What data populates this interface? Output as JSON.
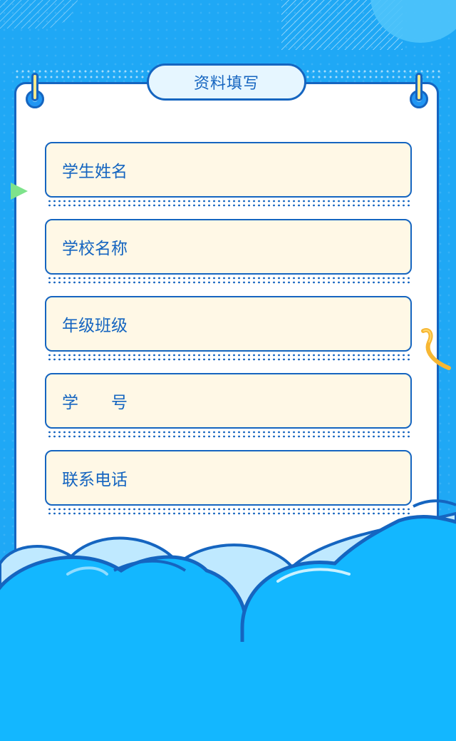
{
  "form": {
    "title": "资料填写",
    "fields": [
      {
        "label": "学生姓名"
      },
      {
        "label": "学校名称"
      },
      {
        "label": "年级班级"
      },
      {
        "label": "学　　号"
      },
      {
        "label": "联系电话"
      }
    ]
  },
  "colors": {
    "background": "#1fa8f5",
    "border": "#1565c0",
    "field_fill": "#fff8e6",
    "cloud": "#13b7ff"
  }
}
